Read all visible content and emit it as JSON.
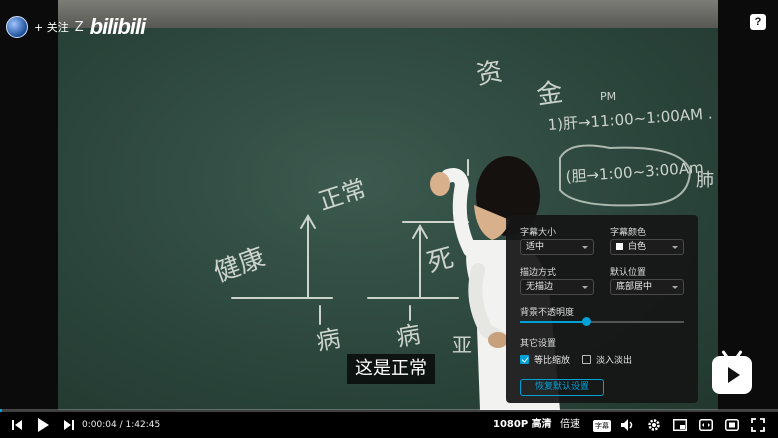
{
  "watermark": {
    "follow_label": "+ 关注",
    "username_partial": "Z",
    "logo_text": "bilibili"
  },
  "help_label": "?",
  "subtitle_text": "这是正常",
  "board_text": {
    "left_word": "健康",
    "top_word": "正常",
    "right_word": "死",
    "bottom_left": "病",
    "bottom_mid": "病",
    "bottom_right": "亚",
    "top_right_1": "资",
    "top_right_2": "金",
    "pm": "PM",
    "time_line_1": "1)肝→11:00~1:00AM .",
    "time_line_2": "(胆→1:00~3:00Am",
    "right_edge": "肺"
  },
  "settings": {
    "size_label": "字幕大小",
    "size_value": "适中",
    "color_label": "字幕颜色",
    "color_value": "白色",
    "outline_label": "描边方式",
    "outline_value": "无描边",
    "position_label": "默认位置",
    "position_value": "底部居中",
    "opacity_label": "背景不透明度",
    "opacity_value": 0.4,
    "other_label": "其它设置",
    "scale_label": "等比缩放",
    "scale_checked": true,
    "fade_label": "淡入淡出",
    "fade_checked": false,
    "reset_label": "恢复默认设置"
  },
  "controls": {
    "current_time": "0:00:04",
    "separator": "/",
    "duration": "1:42:45",
    "progress_fraction": 0.0007,
    "quality_label": "1080P 高清",
    "speed_label": "倍速",
    "subtitle_btn_label": "字幕"
  },
  "colors": {
    "accent": "#00a1d6",
    "board": "#2f4a40"
  }
}
